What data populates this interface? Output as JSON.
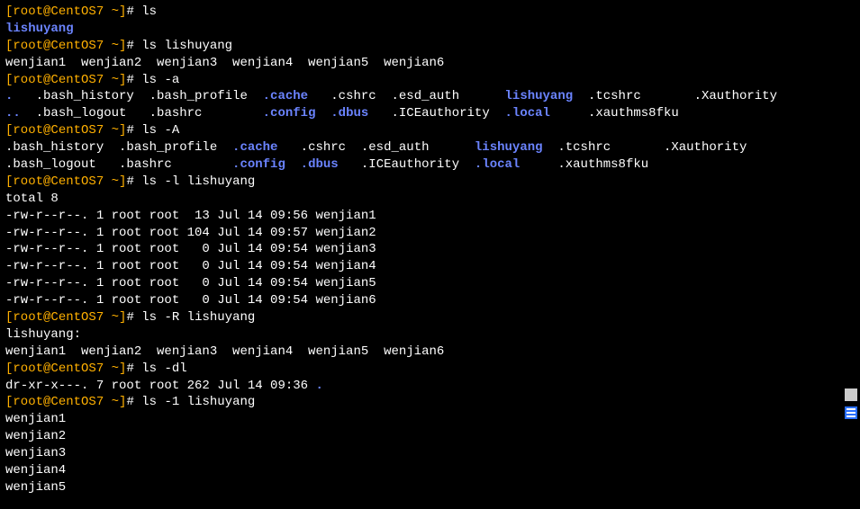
{
  "prompt": {
    "l": "[",
    "user": "root",
    "at": "@",
    "host": "CentOS7",
    "path": " ~",
    "r": "]",
    "hash": "# "
  },
  "cmds": {
    "c1": "ls",
    "c2": "ls lishuyang",
    "c3": "ls -a",
    "c4": "ls -A",
    "c5": "ls -l lishuyang",
    "c6": "ls -R lishuyang",
    "c7": "ls -dl",
    "c8": "ls -1 lishuyang"
  },
  "out": {
    "dir_lishuyang": "lishuyang",
    "ls_dir_row": "wenjian1  wenjian2  wenjian3  wenjian4  wenjian5  wenjian6",
    "lsa_r1": {
      "p1": ".",
      "p2": "   .bash_history  .bash_profile  ",
      "d1": ".cache",
      "p3": "   .cshrc  .esd_auth      ",
      "d2": "lishuyang",
      "p4": "  .tcshrc       .Xauthority"
    },
    "lsa_r2": {
      "d0": "..",
      "p1": "  .bash_logout   .bashrc        ",
      "d1": ".config",
      "p2": "  ",
      "d2": ".dbus",
      "p3": "   .ICEauthority  ",
      "d3": ".local",
      "p4": "     .xauthms8fku"
    },
    "lsA_r1": {
      "p1": ".bash_history  .bash_profile  ",
      "d1": ".cache",
      "p2": "   .cshrc  .esd_auth      ",
      "d2": "lishuyang",
      "p3": "  .tcshrc       .Xauthority"
    },
    "lsA_r2": {
      "p1": ".bash_logout   .bashrc        ",
      "d1": ".config",
      "p2": "  ",
      "d2": ".dbus",
      "p3": "   .ICEauthority  ",
      "d3": ".local",
      "p4": "     .xauthms8fku"
    },
    "lsl_total": "total 8",
    "lsl_rows": [
      "-rw-r--r--. 1 root root  13 Jul 14 09:56 wenjian1",
      "-rw-r--r--. 1 root root 104 Jul 14 09:57 wenjian2",
      "-rw-r--r--. 1 root root   0 Jul 14 09:54 wenjian3",
      "-rw-r--r--. 1 root root   0 Jul 14 09:54 wenjian4",
      "-rw-r--r--. 1 root root   0 Jul 14 09:54 wenjian5",
      "-rw-r--r--. 1 root root   0 Jul 14 09:54 wenjian6"
    ],
    "lsR_header": "lishuyang:",
    "lsdl_pre": "dr-xr-x---. 7 root root 262 Jul 14 09:36 ",
    "lsdl_dot": ".",
    "ls1_rows": [
      "wenjian1",
      "wenjian2",
      "wenjian3",
      "wenjian4",
      "wenjian5"
    ]
  }
}
